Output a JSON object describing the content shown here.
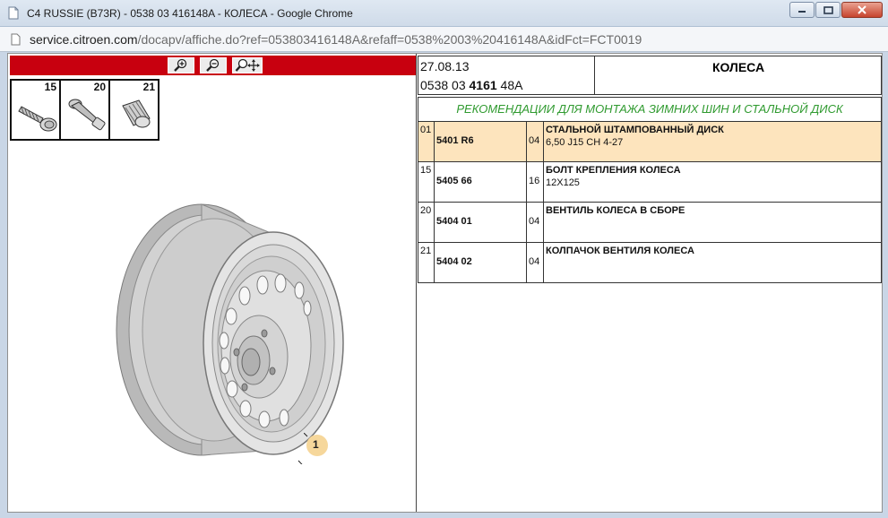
{
  "window": {
    "title": "C4 RUSSIE (B73R) - 0538 03 416148A - КОЛЕСА - Google Chrome"
  },
  "address": {
    "url_host": "service.citroen.com",
    "url_path": "/docapv/affiche.do?ref=053803416148A&refaff=0538%2003%20416148A&idFct=FCT0019"
  },
  "toolbar": {
    "buttons": [
      "zoom-in-icon",
      "zoom-out-icon",
      "zoom-pan-icon"
    ]
  },
  "thumbnails": [
    {
      "number": "15",
      "icon": "wheel-bolt-icon"
    },
    {
      "number": "20",
      "icon": "valve-icon"
    },
    {
      "number": "21",
      "icon": "valve-cap-icon"
    }
  ],
  "illustration": {
    "callout": "1"
  },
  "header": {
    "date": "27.08.13",
    "ref_prefix": "0538 03",
    "ref_bold": "4161",
    "ref_suffix": "48A",
    "section_title": "КОЛЕСА"
  },
  "recommendation": "РЕКОМЕНДАЦИИ ДЛЯ МОНТАЖА ЗИМНИХ ШИН И СТАЛЬНОЙ ДИСК",
  "parts": [
    {
      "index": "01",
      "ref": "5401 R6",
      "qty": "04",
      "description": "СТАЛЬНОЙ ШТАМПОВАННЫЙ ДИСК",
      "spec": "6,50 J15 CH 4-27"
    },
    {
      "index": "15",
      "ref": "5405 66",
      "qty": "16",
      "description": "БОЛТ КРЕПЛЕНИЯ КОЛЕСА",
      "spec": "12X125"
    },
    {
      "index": "20",
      "ref": "5404 01",
      "qty": "04",
      "description": "ВЕНТИЛЬ КОЛЕСА В СБОРЕ",
      "spec": ""
    },
    {
      "index": "21",
      "ref": "5404 02",
      "qty": "04",
      "description": "КОЛПАЧОК ВЕНТИЛЯ КОЛЕСА",
      "spec": ""
    }
  ],
  "colors": {
    "toolbar_red": "#c8000f",
    "highlight_row": "#fde4bd",
    "recommend_green": "#2f9a2f",
    "callout_fill": "#f6d79b"
  }
}
